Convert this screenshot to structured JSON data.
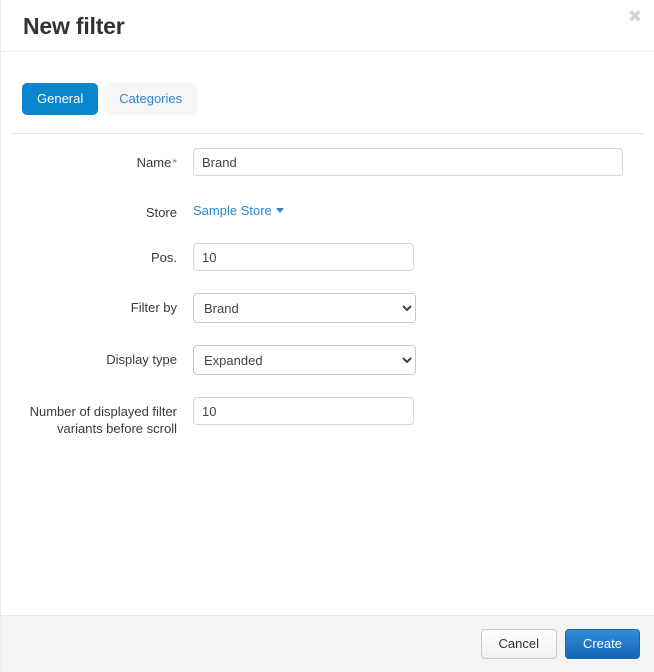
{
  "header": {
    "title": "New filter",
    "close_label": "✖"
  },
  "tabs": [
    {
      "label": "General",
      "active": true
    },
    {
      "label": "Categories",
      "active": false
    }
  ],
  "form": {
    "name": {
      "label": "Name",
      "required_marker": "*",
      "value": "Brand",
      "placeholder": ""
    },
    "store": {
      "label": "Store",
      "value": "Sample Store"
    },
    "pos": {
      "label": "Pos.",
      "value": "10",
      "placeholder": ""
    },
    "filter_by": {
      "label": "Filter by",
      "value": "Brand",
      "options": [
        "Brand"
      ]
    },
    "display_type": {
      "label": "Display type",
      "value": "Expanded",
      "options": [
        "Expanded"
      ]
    },
    "variants": {
      "label_line1": "Number of displayed filter",
      "label_line2": "variants before scroll",
      "value": "10",
      "placeholder": ""
    }
  },
  "footer": {
    "cancel_label": "Cancel",
    "create_label": "Create"
  },
  "colors": {
    "accent": "#0785cd",
    "link": "#2a87d0",
    "required": "#e8554d",
    "primary_button": "#1e6fbe",
    "footer_bg": "#f4f4f4"
  }
}
